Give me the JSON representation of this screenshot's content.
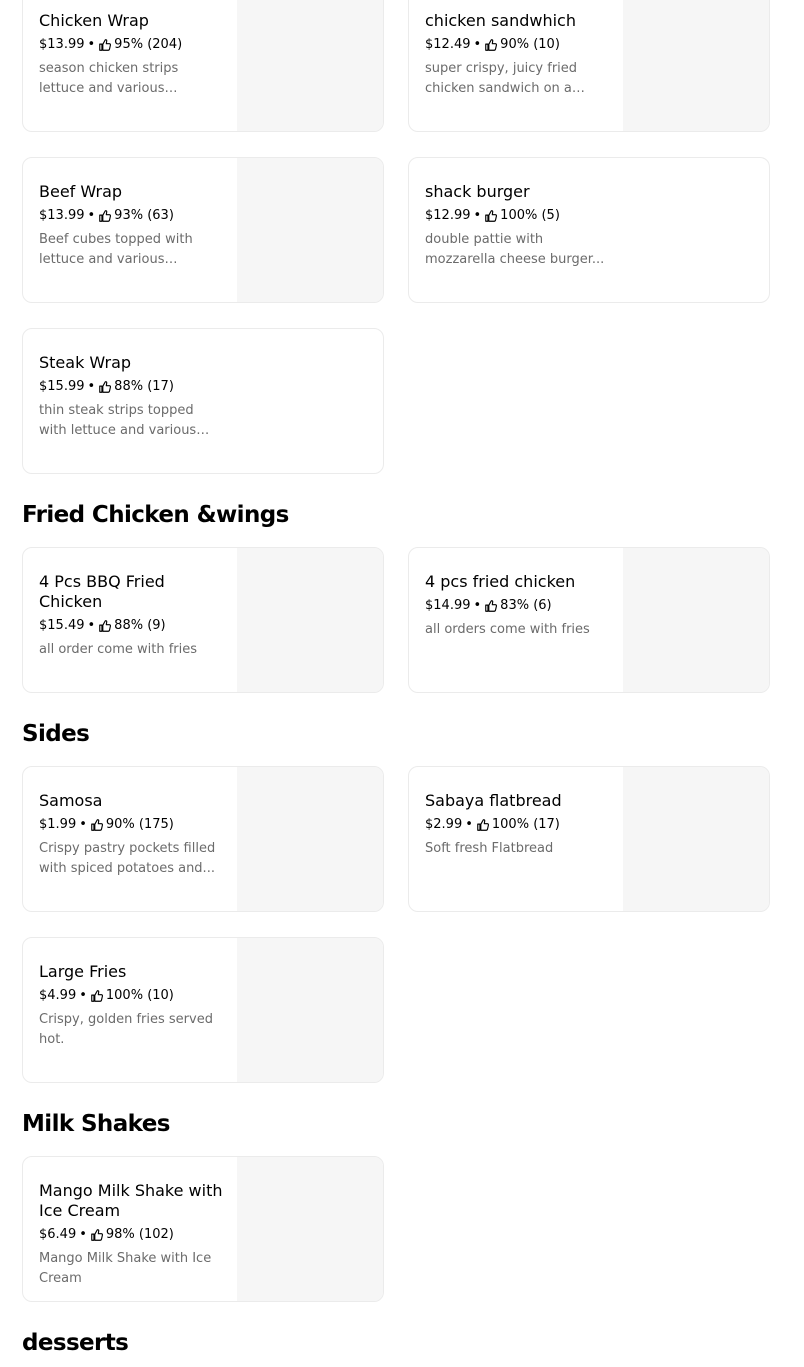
{
  "sections": {
    "fried_chicken": "Fried Chicken &wings",
    "sides": "Sides",
    "milk_shakes": "Milk Shakes",
    "desserts": "desserts"
  },
  "items": {
    "chicken_wrap": {
      "name": "Chicken Wrap",
      "price": "$13.99",
      "rating": "95% (204)",
      "desc": "season chicken strips lettuce and various sauces..."
    },
    "chicken_sandwhich": {
      "name": "chicken sandwhich",
      "price": "$12.49",
      "rating": "90% (10)",
      "desc": "super crispy, juicy fried chicken sandwich on a soft..."
    },
    "beef_wrap": {
      "name": "Beef Wrap",
      "price": "$13.99",
      "rating": "93% (63)",
      "desc": "Beef cubes topped with lettuce and various sauces..."
    },
    "shack_burger": {
      "name": "shack burger",
      "price": "$12.99",
      "rating": "100% (5)",
      "desc": "double pattie with mozzarella cheese burger..."
    },
    "steak_wrap": {
      "name": "Steak Wrap",
      "price": "$15.99",
      "rating": "88% (17)",
      "desc": "thin steak strips topped with lettuce and various sauces..."
    },
    "bbq_fried_chicken": {
      "name": "4 Pcs BBQ Fried Chicken",
      "price": "$15.49",
      "rating": "88% (9)",
      "desc": "all order come with fries"
    },
    "fried_chicken": {
      "name": "4 pcs fried chicken",
      "price": "$14.99",
      "rating": "83% (6)",
      "desc": "all orders come with fries"
    },
    "samosa": {
      "name": "Samosa",
      "price": "$1.99",
      "rating": "90% (175)",
      "desc": "Crispy pastry pockets filled with spiced potatoes and..."
    },
    "sabaya": {
      "name": "Sabaya flatbread",
      "price": "$2.99",
      "rating": "100% (17)",
      "desc": "Soft fresh Flatbread"
    },
    "large_fries": {
      "name": "Large Fries",
      "price": "$4.99",
      "rating": "100% (10)",
      "desc": "Crispy, golden fries served hot."
    },
    "mango_shake": {
      "name": "Mango Milk Shake with Ice Cream",
      "price": "$6.49",
      "rating": "98% (102)",
      "desc": "Mango Milk Shake with Ice Cream"
    }
  },
  "separator": "•",
  "icons": {
    "rating": "thumbs-up-icon"
  },
  "colors": {
    "text": "#000000",
    "muted": "#6b6b6b",
    "border": "#ebebeb",
    "image_placeholder": "#f6f6f6"
  }
}
